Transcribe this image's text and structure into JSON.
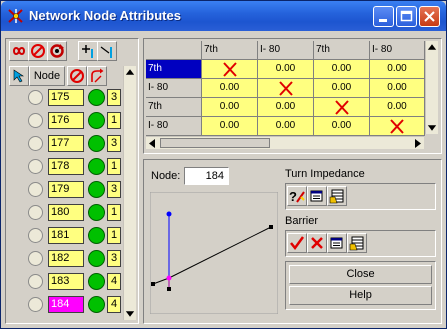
{
  "window": {
    "title": "Network Node Attributes",
    "accent": "#2563dc"
  },
  "toolbar": {
    "icons": [
      "infinity-icon",
      "no-entry-icon",
      "refresh-icon",
      "add-icon",
      "ramp-icon"
    ]
  },
  "node_list": {
    "header_label": "Node",
    "rows": [
      {
        "name": "175",
        "count": "3",
        "selected": false
      },
      {
        "name": "176",
        "count": "1",
        "selected": false
      },
      {
        "name": "177",
        "count": "3",
        "selected": false
      },
      {
        "name": "178",
        "count": "1",
        "selected": false
      },
      {
        "name": "179",
        "count": "3",
        "selected": false
      },
      {
        "name": "180",
        "count": "1",
        "selected": false
      },
      {
        "name": "181",
        "count": "1",
        "selected": false
      },
      {
        "name": "182",
        "count": "3",
        "selected": false
      },
      {
        "name": "183",
        "count": "4",
        "selected": false
      },
      {
        "name": "184",
        "count": "4",
        "selected": true
      }
    ]
  },
  "impedance_grid": {
    "columns": [
      "7th",
      "I- 80",
      "7th",
      "I- 80"
    ],
    "rows": [
      {
        "label": "7th",
        "selected": true,
        "cells": [
          "X",
          "0.00",
          "0.00",
          "0.00"
        ]
      },
      {
        "label": "I- 80",
        "selected": false,
        "cells": [
          "0.00",
          "X",
          "0.00",
          "0.00"
        ]
      },
      {
        "label": "7th",
        "selected": false,
        "cells": [
          "0.00",
          "0.00",
          "X",
          "0.00"
        ]
      },
      {
        "label": "I- 80",
        "selected": false,
        "cells": [
          "0.00",
          "0.00",
          "0.00",
          "X"
        ]
      }
    ]
  },
  "node_detail": {
    "label": "Node:",
    "value": "184"
  },
  "turn_impedance": {
    "label": "Turn Impedance"
  },
  "barrier": {
    "label": "Barrier"
  },
  "buttons": {
    "close": "Close",
    "help": "Help"
  }
}
